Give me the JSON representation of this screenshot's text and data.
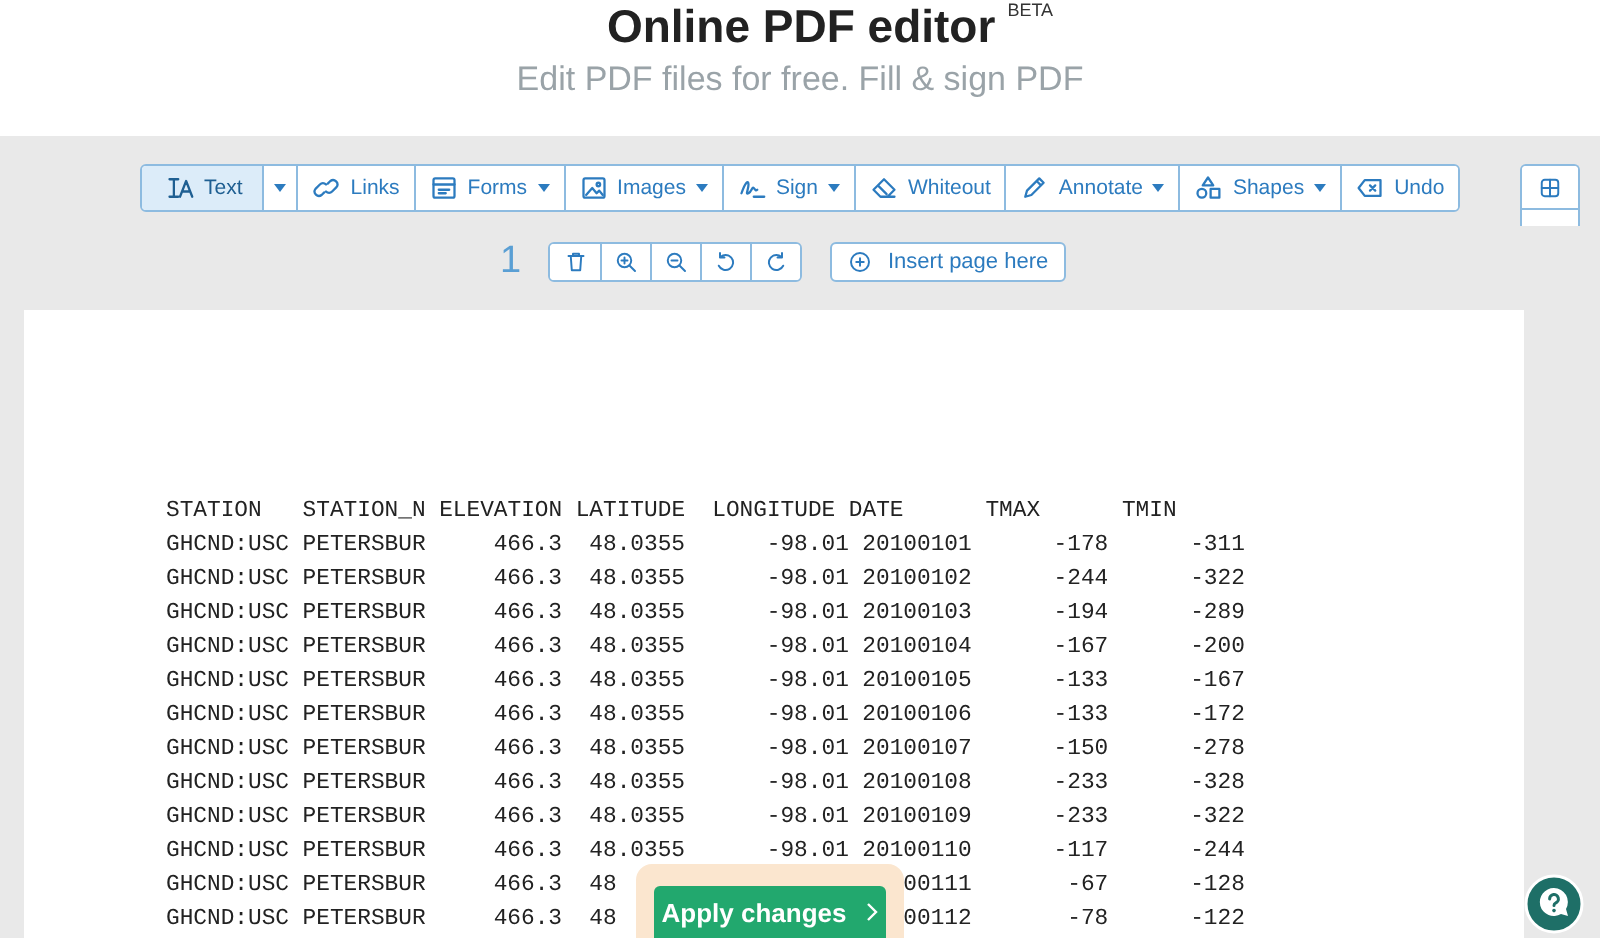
{
  "header": {
    "title": "Online PDF editor",
    "badge": "BETA",
    "subtitle": "Edit PDF files for free. Fill & sign PDF"
  },
  "toolbar": [
    {
      "label": "Text",
      "kind": "split",
      "selected": true
    },
    {
      "label": "Links",
      "kind": "plain",
      "selected": false
    },
    {
      "label": "Forms",
      "kind": "menu",
      "selected": false
    },
    {
      "label": "Images",
      "kind": "menu",
      "selected": false
    },
    {
      "label": "Sign",
      "kind": "menu",
      "selected": false
    },
    {
      "label": "Whiteout",
      "kind": "plain",
      "selected": false
    },
    {
      "label": "Annotate",
      "kind": "menu",
      "selected": false
    },
    {
      "label": "Shapes",
      "kind": "menu",
      "selected": false
    },
    {
      "label": "Undo",
      "kind": "plain",
      "selected": false
    }
  ],
  "page_controls": {
    "page_number": "1",
    "insert_button": "Insert page here"
  },
  "table": {
    "columns": [
      "STATION",
      "STATION_N",
      "ELEVATION",
      "LATITUDE",
      "LONGITUDE",
      "DATE",
      "TMAX",
      "TMIN"
    ],
    "rows": [
      [
        "GHCND:USC",
        "PETERSBUR",
        "466.3",
        "48.0355",
        "-98.01",
        "20100101",
        "-178",
        "-311"
      ],
      [
        "GHCND:USC",
        "PETERSBUR",
        "466.3",
        "48.0355",
        "-98.01",
        "20100102",
        "-244",
        "-322"
      ],
      [
        "GHCND:USC",
        "PETERSBUR",
        "466.3",
        "48.0355",
        "-98.01",
        "20100103",
        "-194",
        "-289"
      ],
      [
        "GHCND:USC",
        "PETERSBUR",
        "466.3",
        "48.0355",
        "-98.01",
        "20100104",
        "-167",
        "-200"
      ],
      [
        "GHCND:USC",
        "PETERSBUR",
        "466.3",
        "48.0355",
        "-98.01",
        "20100105",
        "-133",
        "-167"
      ],
      [
        "GHCND:USC",
        "PETERSBUR",
        "466.3",
        "48.0355",
        "-98.01",
        "20100106",
        "-133",
        "-172"
      ],
      [
        "GHCND:USC",
        "PETERSBUR",
        "466.3",
        "48.0355",
        "-98.01",
        "20100107",
        "-150",
        "-278"
      ],
      [
        "GHCND:USC",
        "PETERSBUR",
        "466.3",
        "48.0355",
        "-98.01",
        "20100108",
        "-233",
        "-328"
      ],
      [
        "GHCND:USC",
        "PETERSBUR",
        "466.3",
        "48.0355",
        "-98.01",
        "20100109",
        "-233",
        "-322"
      ],
      [
        "GHCND:USC",
        "PETERSBUR",
        "466.3",
        "48.0355",
        "-98.01",
        "20100110",
        "-117",
        "-244"
      ],
      [
        "GHCND:USC",
        "PETERSBUR",
        "466.3",
        "48",
        null,
        "00111",
        "-67",
        "-128"
      ],
      [
        "GHCND:USC",
        "PETERSBUR",
        "466.3",
        "48",
        null,
        "00112",
        "-78",
        "-122"
      ]
    ]
  },
  "apply_button": "Apply changes"
}
